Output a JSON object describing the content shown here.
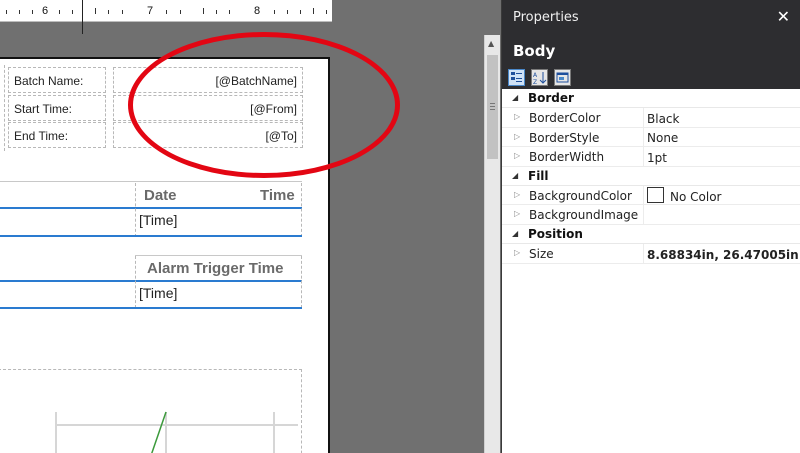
{
  "ruler": {
    "numbers": [
      "6",
      "7",
      "8"
    ]
  },
  "report": {
    "params": [
      {
        "label": "Batch Name:",
        "value": "[@BatchName]"
      },
      {
        "label": "Start Time:",
        "value": "[@From]"
      },
      {
        "label": "End Time:",
        "value": "[@To]"
      }
    ],
    "table1": {
      "header_date": "Date",
      "header_time": "Time",
      "cell_time": "[Time]"
    },
    "table2": {
      "header_alarm": "Alarm Trigger Time",
      "cell_time": "[Time]"
    }
  },
  "properties": {
    "title": "Properties",
    "close_glyph": "✕",
    "object_name": "Body",
    "categories": [
      {
        "name": "Border",
        "rows": [
          {
            "name": "BorderColor",
            "value": "Black"
          },
          {
            "name": "BorderStyle",
            "value": "None"
          },
          {
            "name": "BorderWidth",
            "value": "1pt"
          }
        ]
      },
      {
        "name": "Fill",
        "rows": [
          {
            "name": "BackgroundColor",
            "value": "No Color"
          },
          {
            "name": "BackgroundImage",
            "value": ""
          }
        ]
      },
      {
        "name": "Position",
        "rows": [
          {
            "name": "Size",
            "value": "8.68834in, 26.47005in"
          }
        ]
      }
    ]
  },
  "colors": {
    "annotation": "#e30613",
    "table_rule": "#2a7bd0",
    "panel_header": "#2d2d30",
    "canvas": "#707070"
  }
}
